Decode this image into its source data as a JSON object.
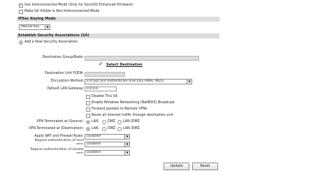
{
  "top_options": {
    "interconnected_label": "Use Interconnected Mode (Only for SonicOS Enhanced firmware)",
    "sa_visible_label": "Make SA Visible in Non-Interconnected Mode"
  },
  "ipsec_keying": {
    "title": "IPSec Keying Mode",
    "mode_value": "Manual Key"
  },
  "establish_sa": {
    "title": "Establish Security Associations (SA)",
    "add_new_label": "Add a New Security Association"
  },
  "form": {
    "dest_group_label": "Destination Group/Node:",
    "select_destination_label": "Select Destination",
    "dest_fqdn_label": "Destination Unit FQDN:",
    "encryption_label": "Encryption Method:",
    "encryption_value": "Encrypt and Authenticate (ESP DES HMAC MD5)",
    "gateway_label": "Default LAN Gateway:",
    "gateway_value": "0.0.0.0",
    "disable_sa_label": "Disable This SA",
    "netbios_label": "Enable Windows Networking (NetBIOS) Broadcast",
    "forward_label": "Forward packets to Remote VPNs",
    "route_all_label": "Route all internet traffic through destination unit",
    "vpn_source_label": "VPN Terminated at (Source):",
    "vpn_dest_label": "VPN Terminated at (Destination):",
    "radio_lan": "LAN",
    "radio_dmz": "DMZ",
    "radio_lan_dmz": "LAN /DMZ",
    "nat_label": "Apply NAT and Firewall Rules:",
    "nat_value": "Disabled",
    "auth_local_label_1": "Require authentication of local",
    "auth_local_label_2": "users:",
    "auth_local_value": "Disabled",
    "auth_remote_label_1": "Require authentication of remote",
    "auth_remote_label_2": "users:",
    "auth_remote_value": "Disabled"
  },
  "buttons": {
    "update": "Update",
    "reset": "Reset"
  },
  "icons": {
    "select_destination": "checkmark-icon",
    "dropdown": "chevron-down-icon"
  },
  "colors": {
    "section_bg": "#dcdcdc",
    "disabled_field_bg": "#dcdcdc",
    "checkmark_blue": "#1e5fa8"
  }
}
